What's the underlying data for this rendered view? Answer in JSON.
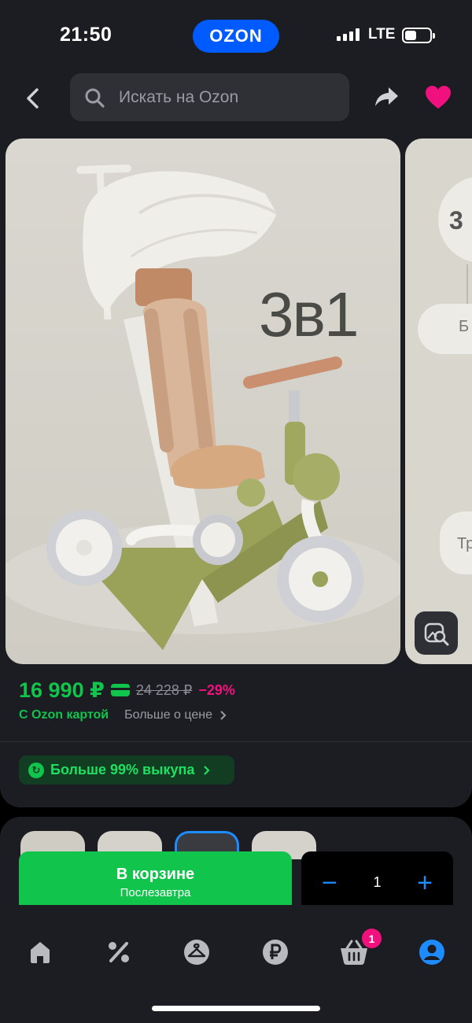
{
  "status_bar": {
    "time": "21:50",
    "network": "LTE",
    "app_pill": "OZON"
  },
  "header": {
    "search_placeholder": "Искать на Ozon",
    "back_icon": "chevron-left-icon",
    "share_icon": "share-icon",
    "favorite_icon": "heart-icon"
  },
  "product": {
    "image_overlay_text": "3в1",
    "price": "16 990 ₽",
    "old_price": "24 228 ₽",
    "discount": "−29%",
    "ozon_card_label": "С Ozon картой",
    "more_about_price": "Больше о цене",
    "buyout_label": "Больше 99% выкупа"
  },
  "next_photo": {
    "t1": "3",
    "t2": "Б",
    "t3": "Тр"
  },
  "cart": {
    "button_label": "В корзине",
    "delivery": "Послезавтра",
    "quantity": "1",
    "minus": "−",
    "plus": "+"
  },
  "tabbar": {
    "items": [
      "home-icon",
      "percent-icon",
      "hanger-icon",
      "ruble-icon",
      "cart-icon",
      "profile-icon"
    ],
    "cart_badge": "1"
  },
  "colors": {
    "brand_blue": "#005bff",
    "green": "#10c44c",
    "pink": "#f1117e",
    "accent_blue": "#1e8bff",
    "surface": "#1c1d22"
  }
}
